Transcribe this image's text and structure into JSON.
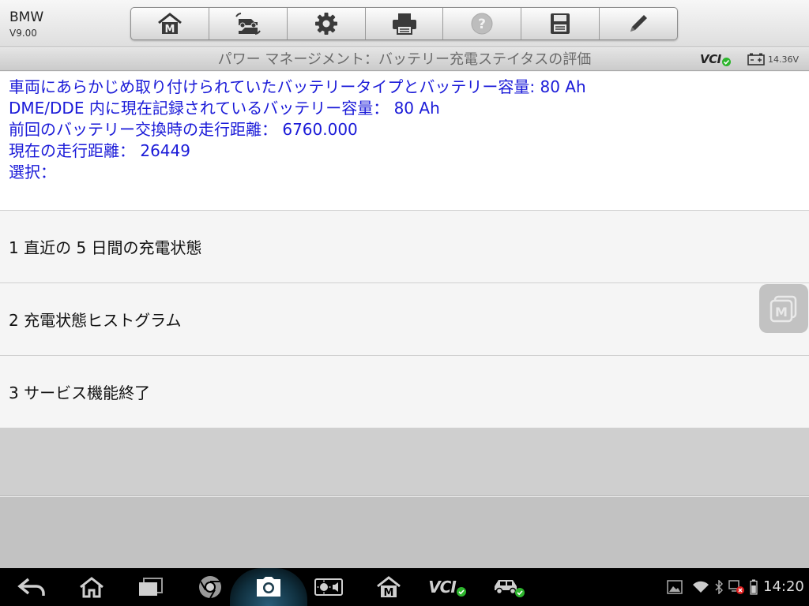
{
  "app": {
    "make": "BMW",
    "version": "V9.00"
  },
  "toolbar": {
    "buttons": [
      {
        "icon": "home-m-icon"
      },
      {
        "icon": "vehicle-swap-icon"
      },
      {
        "icon": "gear-icon"
      },
      {
        "icon": "printer-icon"
      },
      {
        "icon": "help-icon"
      },
      {
        "icon": "save-icon"
      },
      {
        "icon": "pencil-icon"
      }
    ]
  },
  "titlebar": {
    "title": "パワー マネージメント：バッテリー充電ステイタスの評価",
    "vci_label": "VCI",
    "battery_voltage": "14.36V"
  },
  "info": {
    "lines": [
      "車両にあらかじめ取り付けられていたバッテリータイプとバッテリー容量: 80 Ah",
      "DME/DDE 内に現在記録されているバッテリー容量： 80 Ah",
      "前回のバッテリー交換時の走行距離： 6760.000",
      "現在の走行距離： 26449",
      "選択："
    ]
  },
  "options": [
    {
      "label": "1 直近の 5 日間の充電状態"
    },
    {
      "label": "2 充電状態ヒストグラム"
    },
    {
      "label": "3 サービス機能終了"
    }
  ],
  "navbar": {
    "vci_label": "VCI",
    "clock": "14:20"
  },
  "colors": {
    "info_text": "#1a1ad8",
    "status_ok": "#2db52d",
    "status_error": "#e02020"
  }
}
